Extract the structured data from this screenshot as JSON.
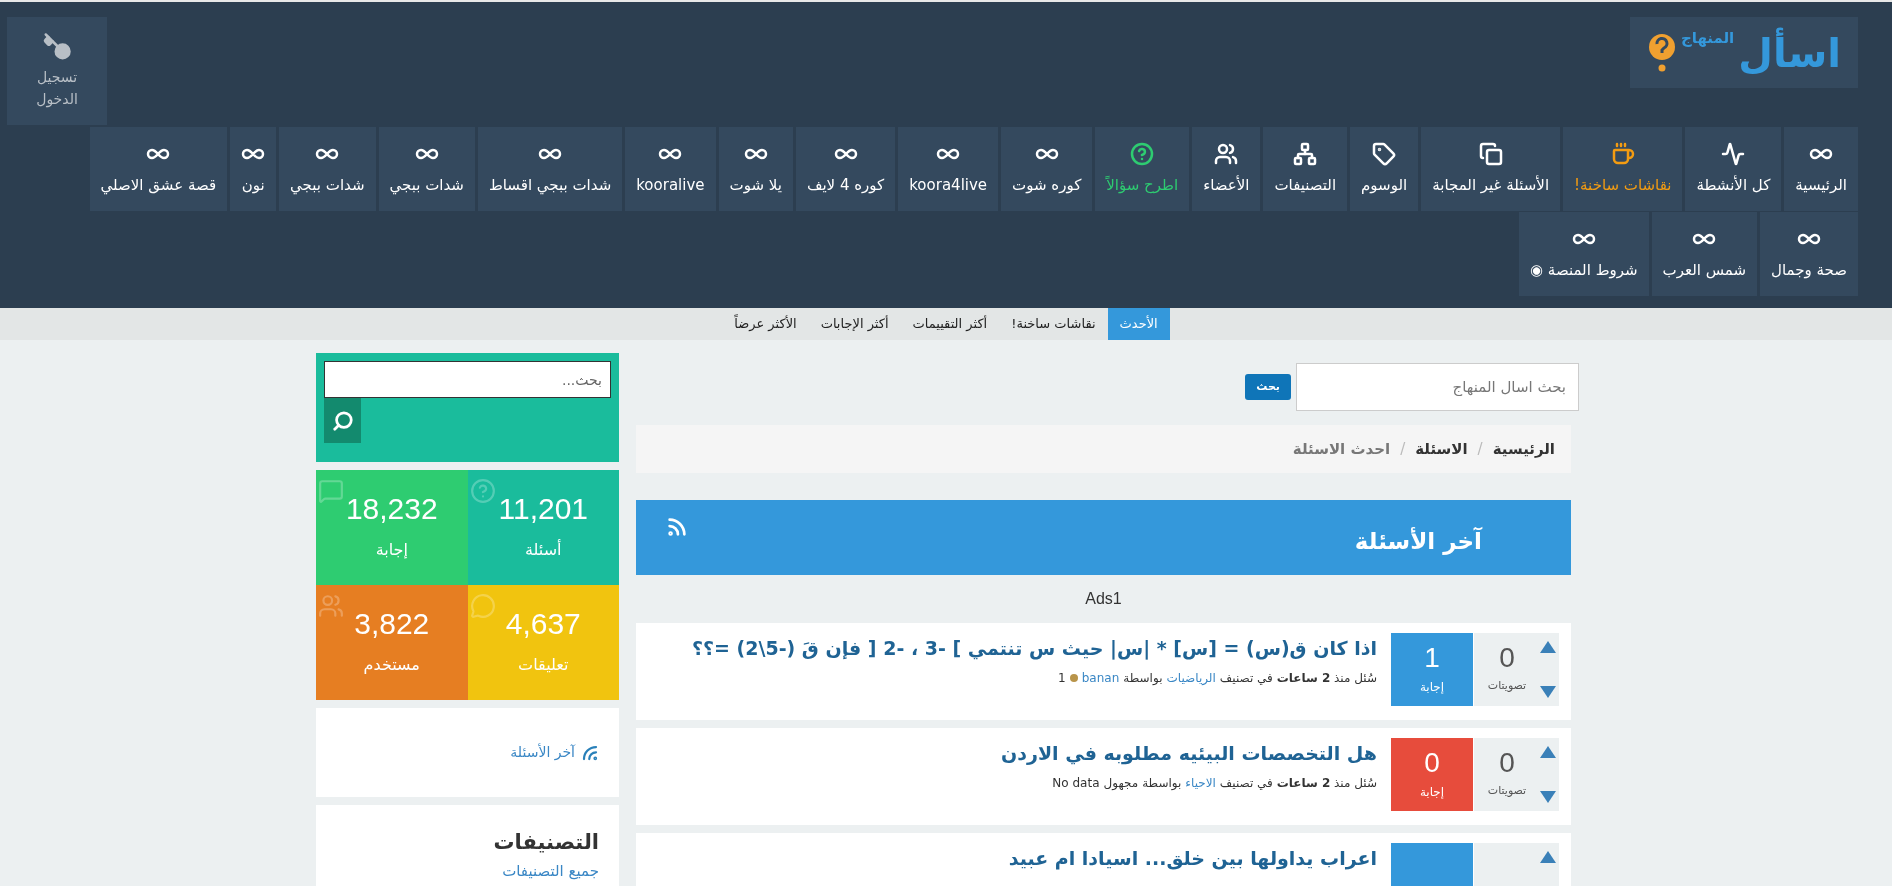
{
  "logo": {
    "main": "اسأل",
    "sub": "المنهاج"
  },
  "login": {
    "label": "تسجيل الدخول"
  },
  "nav": [
    {
      "label": "الرئيسية",
      "kind": "infinity"
    },
    {
      "label": "كل الأنشطة",
      "kind": "activity"
    },
    {
      "label": "نقاشات ساخنة!",
      "kind": "hot"
    },
    {
      "label": "الأسئلة غير المجابة",
      "kind": "unanswered"
    },
    {
      "label": "الوسوم",
      "kind": "tags"
    },
    {
      "label": "التصنيفات",
      "kind": "categories"
    },
    {
      "label": "الأعضاء",
      "kind": "users"
    },
    {
      "label": "اطرح سؤالاً",
      "kind": "ask"
    },
    {
      "label": "كوره شوت",
      "kind": "infinity"
    },
    {
      "label": "koora4live",
      "kind": "infinity"
    },
    {
      "label": "كوره 4 لايف",
      "kind": "infinity"
    },
    {
      "label": "يلا شوت",
      "kind": "infinity"
    },
    {
      "label": "kooralive",
      "kind": "infinity"
    },
    {
      "label": "شدات ببجي اقساط",
      "kind": "infinity"
    },
    {
      "label": "شدات ببجي",
      "kind": "infinity"
    },
    {
      "label": "شدات ببجي",
      "kind": "infinity"
    },
    {
      "label": "نون",
      "kind": "infinity"
    },
    {
      "label": "قصة عشق الاصلي",
      "kind": "infinity"
    },
    {
      "label": "صحة وجمال",
      "kind": "infinity"
    },
    {
      "label": "شمس العرب",
      "kind": "infinity"
    },
    {
      "label": "شروط المنصة ◉",
      "kind": "infinity"
    }
  ],
  "sort_tabs": [
    {
      "label": "الأحدث",
      "selected": true
    },
    {
      "label": "نقاشات ساخنة!",
      "selected": false
    },
    {
      "label": "أكثر التقييمات",
      "selected": false
    },
    {
      "label": "أكثر الإجابات",
      "selected": false
    },
    {
      "label": "الأكثر عرضاً",
      "selected": false
    }
  ],
  "search": {
    "placeholder": "بحث اسال المنهاج",
    "button": "بحث"
  },
  "breadcrumb": [
    {
      "label": "الرئيسية",
      "current": false
    },
    {
      "label": "الاسئلة",
      "current": false,
      "separator": "/"
    },
    {
      "label": "احدث الاسئلة",
      "current": true,
      "separator": "/"
    }
  ],
  "section": {
    "title": "آخر الأسئلة",
    "ad": "Ads1"
  },
  "questions": [
    {
      "votes": "0",
      "votes_label": "تصويتات",
      "answers": "1",
      "answers_label": "إجابة",
      "answered": true,
      "title": "اذا كان ق(س) = [س] * |س| حيث س تنتمي ] -3 ، -2 [ فإن قَ (-5\\2) =؟؟",
      "meta": {
        "asked": "سُئل منذ **2 ساعات** في تصنيف",
        "category": "الرياضيات",
        "by": "بواسطة",
        "user": "banan",
        "user_linked": true,
        "medal": true,
        "points": "1"
      }
    },
    {
      "votes": "0",
      "votes_label": "تصويتات",
      "answers": "0",
      "answers_label": "إجابة",
      "answered": false,
      "title": "هل التخصصات البيئيه مطلوبه في الاردن",
      "meta": {
        "asked": "سُئل منذ **2 ساعات** في تصنيف",
        "category": "الاحياء",
        "by": "بواسطة",
        "user": "مجهول",
        "user_linked": false,
        "medal": false,
        "points": "No data"
      }
    },
    {
      "answered": true,
      "title": "اعراب يداولها بين خلق... اسيادا ام عبيد"
    }
  ],
  "sidebar": {
    "search": {
      "placeholder": "بحث..."
    },
    "stats": [
      {
        "value": "11,201",
        "label": "أسئلة",
        "kind": "questions",
        "color": "#1abc9c"
      },
      {
        "value": "18,232",
        "label": "إجابة",
        "kind": "answers",
        "color": "#2ecc71"
      },
      {
        "value": "4,637",
        "label": "تعليقات",
        "kind": "comments",
        "color": "#f1c40f"
      },
      {
        "value": "3,822",
        "label": "مستخدم",
        "kind": "users",
        "color": "#e67e22"
      }
    ],
    "feed_link": "آخر الأسئلة",
    "categories": {
      "title": "التصنيفات",
      "link": "جميع التصنيفات"
    }
  }
}
